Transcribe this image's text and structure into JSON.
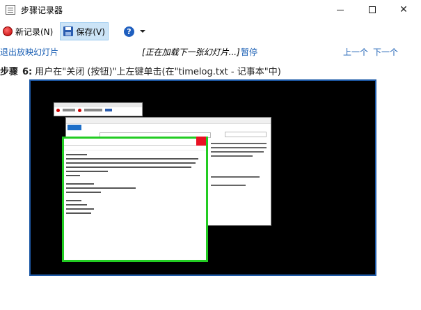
{
  "window": {
    "title": "步骤记录器"
  },
  "toolbar": {
    "new_record_label": "新记录(N)",
    "save_label": "保存(V)",
    "help_glyph": "?"
  },
  "nav": {
    "exit_slideshow": "退出放映幻灯片",
    "status": "[正在加载下一张幻灯片...]",
    "pause": "暂停",
    "prev": "上一个",
    "next": "下一个"
  },
  "step": {
    "label": "步骤",
    "number": "6:",
    "description": "用户在\"关闭 (按钮)\"上左键单击(在\"timelog.txt - 记事本\"中)"
  },
  "colors": {
    "link": "#1a5fb4",
    "slide_border": "#1e5aa8",
    "highlight": "#22cc22",
    "close_red": "#e81123"
  }
}
